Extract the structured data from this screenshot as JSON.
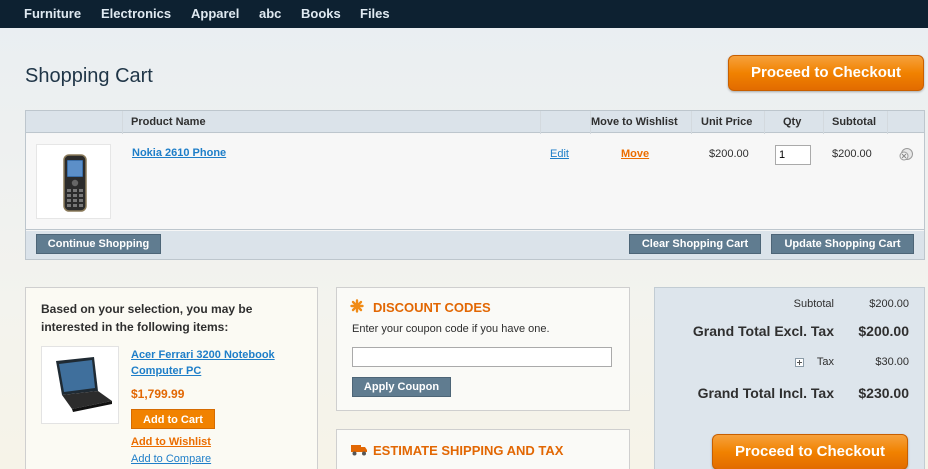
{
  "nav": {
    "items": [
      "Furniture",
      "Electronics",
      "Apparel",
      "abc",
      "Books",
      "Files"
    ]
  },
  "page": {
    "title": "Shopping Cart",
    "checkout_label": "Proceed to Checkout"
  },
  "cart": {
    "columns": {
      "product": "Product Name",
      "wishlist": "Move to Wishlist",
      "unit_price": "Unit Price",
      "qty": "Qty",
      "subtotal": "Subtotal"
    },
    "items": [
      {
        "name": "Nokia 2610 Phone",
        "edit": "Edit",
        "move": "Move",
        "unit_price": "$200.00",
        "qty": "1",
        "subtotal": "$200.00",
        "image": "phone-image"
      }
    ],
    "buttons": {
      "continue": "Continue Shopping",
      "clear": "Clear Shopping Cart",
      "update": "Update Shopping Cart"
    }
  },
  "crosssell": {
    "heading": "Based on your selection, you may be interested in the following items:",
    "product": {
      "name": "Acer Ferrari 3200 Notebook Computer PC",
      "price": "$1,799.99",
      "add_to_cart": "Add to Cart",
      "add_to_wishlist": "Add to Wishlist",
      "add_to_compare": "Add to Compare",
      "image": "laptop-image"
    }
  },
  "coupon": {
    "title": "DISCOUNT CODES",
    "prompt": "Enter your coupon code if you have one.",
    "value": "",
    "apply": "Apply Coupon",
    "icon": "discount-icon"
  },
  "shipping": {
    "title": "ESTIMATE SHIPPING AND TAX",
    "icon": "truck-icon"
  },
  "totals": {
    "subtotal_label": "Subtotal",
    "subtotal": "$200.00",
    "grand_excl_label": "Grand Total Excl. Tax",
    "grand_excl": "$200.00",
    "tax_label": "Tax",
    "tax": "$30.00",
    "grand_incl_label": "Grand Total Incl. Tax",
    "grand_incl": "$230.00"
  },
  "colors": {
    "nav_bg": "#0d2131",
    "accent_orange": "#f18200",
    "link_blue": "#1e7ec8",
    "button_grey": "#607c90"
  }
}
